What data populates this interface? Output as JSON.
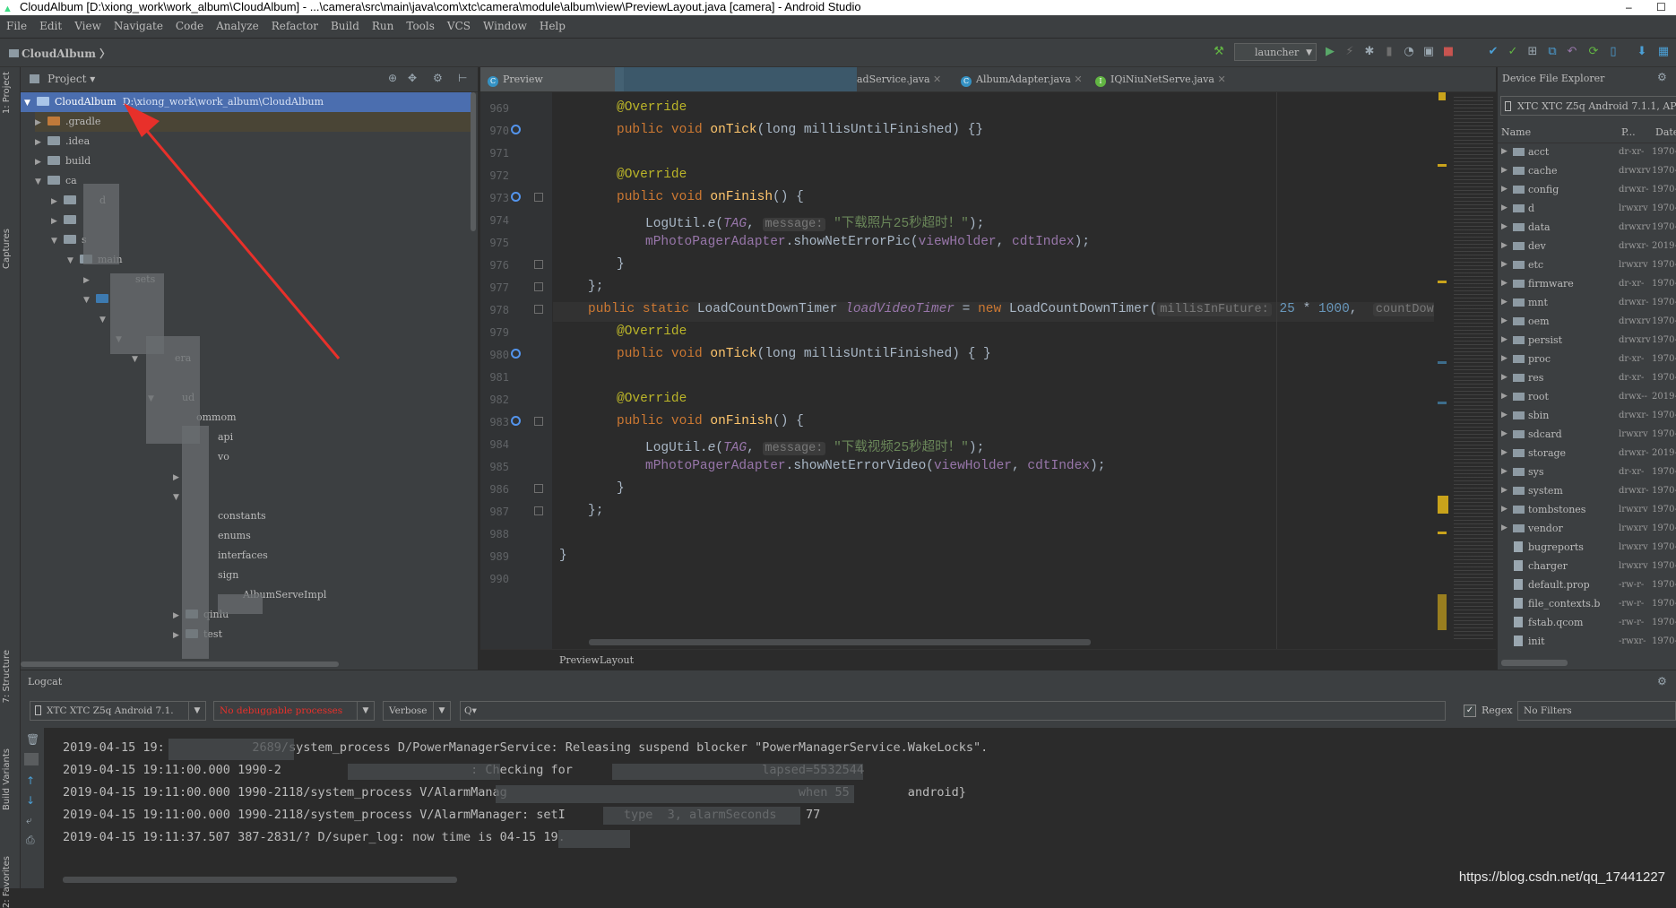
{
  "window": {
    "title": "CloudAlbum [D:\\xiong_work\\work_album\\CloudAlbum] - ...\\camera\\src\\main\\java\\com\\xtc\\camera\\module\\album\\view\\PreviewLayout.java [camera] - Android Studio",
    "minimize": "–",
    "maximize": "☐"
  },
  "menu": [
    "File",
    "Edit",
    "View",
    "Navigate",
    "Code",
    "Analyze",
    "Refactor",
    "Build",
    "Run",
    "Tools",
    "VCS",
    "Window",
    "Help"
  ],
  "navbar": {
    "crumb": "CloudAlbum",
    "run_config": "launcher"
  },
  "left_strip": {
    "project_tab": "1: Project",
    "captures_tab": "Captures",
    "structure_tab": "7: Structure",
    "build_variants_tab": "Build Variants",
    "favorites_tab": "2: Favorites"
  },
  "project": {
    "header": "Project",
    "root": {
      "name": "CloudAlbum",
      "path": "D:\\xiong_work\\work_album\\CloudAlbum"
    },
    "items": [
      ".gradle",
      ".idea",
      "build",
      "ca",
      "d",
      "s",
      "main",
      "sets",
      "era",
      "ud",
      "ommom",
      "api",
      "vo",
      "constants",
      "enums",
      "interfaces",
      "sign",
      "AlbumServeImpl",
      "qinlu",
      "test"
    ]
  },
  "tabs": [
    {
      "label": "Preview",
      "icon": "C"
    },
    {
      "label": "adService.java",
      "icon": ""
    },
    {
      "label": "AlbumAdapter.java",
      "icon": "C"
    },
    {
      "label": "IQiNiuNetServe.java",
      "icon": "I"
    }
  ],
  "editor": {
    "line_numbers": [
      "969",
      "970",
      "971",
      "972",
      "973",
      "974",
      "975",
      "976",
      "977",
      "978",
      "979",
      "980",
      "981",
      "982",
      "983",
      "984",
      "985",
      "986",
      "987",
      "988",
      "989",
      "990"
    ],
    "override": "@Override",
    "public_void": "public void ",
    "on_tick": "onTick",
    "on_finish": "onFinish",
    "tick_params": "(long millisUntilFinished) {}",
    "tick_params2": "(long millisUntilFinished) { }",
    "open_brace_call": "() {",
    "logutil": "LogUtil.",
    "e": "e",
    "tag": "TAG",
    "message_hint": "message:",
    "msg_photo": "\"下载照片25秒超时！\"",
    "msg_video": "\"下载视频25秒超时！\"",
    "end_call": ");",
    "adapter": "mPhotoPagerAdapter",
    "show_pic": ".showNetErrorPic(",
    "show_video": ".showNetErrorVideo(",
    "viewholder": "viewHolder",
    "cdt": "cdtIndex",
    "close_brace": "}",
    "close_semi": "};",
    "decl_public": "public static ",
    "decl_type": "LoadCountDownTimer ",
    "decl_var": "loadVideoTimer",
    "decl_eq": " = ",
    "decl_new": "new ",
    "decl_ctor": "LoadCountDownTimer(",
    "hint_millis": "millisInFuture:",
    "num_25": "25",
    "times": " * ",
    "num_1000": "1000",
    "comma": ",",
    "hint_interval": "countDownInterval:",
    "footer": "PreviewLayout"
  },
  "device_explorer": {
    "title": "Device File Explorer",
    "device": "XTC XTC Z5q Android 7.1.1, AP",
    "columns": [
      "Name",
      "P...",
      "Date"
    ],
    "rows": [
      {
        "name": "acct",
        "perm": "dr-xr-",
        "date": "1970-",
        "dir": true
      },
      {
        "name": "cache",
        "perm": "drwxrv",
        "date": "1970-",
        "dir": true
      },
      {
        "name": "config",
        "perm": "drwxr-",
        "date": "1970-",
        "dir": true
      },
      {
        "name": "d",
        "perm": "lrwxrv",
        "date": "1970-",
        "dir": true
      },
      {
        "name": "data",
        "perm": "drwxrv",
        "date": "1970-",
        "dir": true
      },
      {
        "name": "dev",
        "perm": "drwxr-",
        "date": "2019-",
        "dir": true
      },
      {
        "name": "etc",
        "perm": "lrwxrv",
        "date": "1970-",
        "dir": true
      },
      {
        "name": "firmware",
        "perm": "dr-xr-",
        "date": "1970-",
        "dir": true
      },
      {
        "name": "mnt",
        "perm": "drwxr-",
        "date": "1970-",
        "dir": true
      },
      {
        "name": "oem",
        "perm": "drwxrv",
        "date": "1970-",
        "dir": true
      },
      {
        "name": "persist",
        "perm": "drwxrv",
        "date": "1970-",
        "dir": true
      },
      {
        "name": "proc",
        "perm": "dr-xr-",
        "date": "1970-",
        "dir": true
      },
      {
        "name": "res",
        "perm": "dr-xr-",
        "date": "1970-",
        "dir": true
      },
      {
        "name": "root",
        "perm": "drwx--",
        "date": "2019-",
        "dir": true
      },
      {
        "name": "sbin",
        "perm": "drwxr-",
        "date": "1970-",
        "dir": true
      },
      {
        "name": "sdcard",
        "perm": "lrwxrv",
        "date": "1970-",
        "dir": true
      },
      {
        "name": "storage",
        "perm": "drwxr-",
        "date": "2019-",
        "dir": true
      },
      {
        "name": "sys",
        "perm": "dr-xr-",
        "date": "1970-",
        "dir": true
      },
      {
        "name": "system",
        "perm": "drwxr-",
        "date": "1970-",
        "dir": true
      },
      {
        "name": "tombstones",
        "perm": "lrwxrv",
        "date": "1970-",
        "dir": true
      },
      {
        "name": "vendor",
        "perm": "lrwxrv",
        "date": "1970-",
        "dir": true
      },
      {
        "name": "bugreports",
        "perm": "lrwxrv",
        "date": "1970-",
        "dir": false
      },
      {
        "name": "charger",
        "perm": "lrwxrv",
        "date": "1970-",
        "dir": false
      },
      {
        "name": "default.prop",
        "perm": "-rw-r-",
        "date": "1970-",
        "dir": false
      },
      {
        "name": "file_contexts.b",
        "perm": "-rw-r-",
        "date": "1970-",
        "dir": false
      },
      {
        "name": "fstab.qcom",
        "perm": "-rw-r-",
        "date": "1970-",
        "dir": false
      },
      {
        "name": "init",
        "perm": "-rwxr-",
        "date": "1970-",
        "dir": false
      }
    ]
  },
  "logcat": {
    "title": "Logcat",
    "device": "XTC XTC Z5q Android 7.1.",
    "process": "No debuggable processes",
    "level": "Verbose",
    "search_placeholder": "Q▾",
    "regex_label": "Regex",
    "filter": "No Filters",
    "lines": [
      "2019-04-15 19:            2689/system_process D/PowerManagerService: Releasing suspend blocker \"PowerManagerService.WakeLocks\".",
      "2019-04-15 19:11:00.000 1990-2                          : Checking for                          lapsed=5532544",
      "2019-04-15 19:11:00.000 1990-2118/system_process V/AlarmManag                                        when 55        android}",
      "2019-04-15 19:11:00.000 1990-2118/system_process V/AlarmManager: setI        type  3, alarmSeconds    77",
      "2019-04-15 19:11:37.507 387-2831/? D/super_log: now time is 04-15 19.        "
    ]
  },
  "watermark": "https://blog.csdn.net/qq_17441227",
  "colors": {
    "accent_red": "#e8302a",
    "selection": "#4b6eaf",
    "background": "#2b2b2b",
    "panel": "#3c3f41"
  }
}
